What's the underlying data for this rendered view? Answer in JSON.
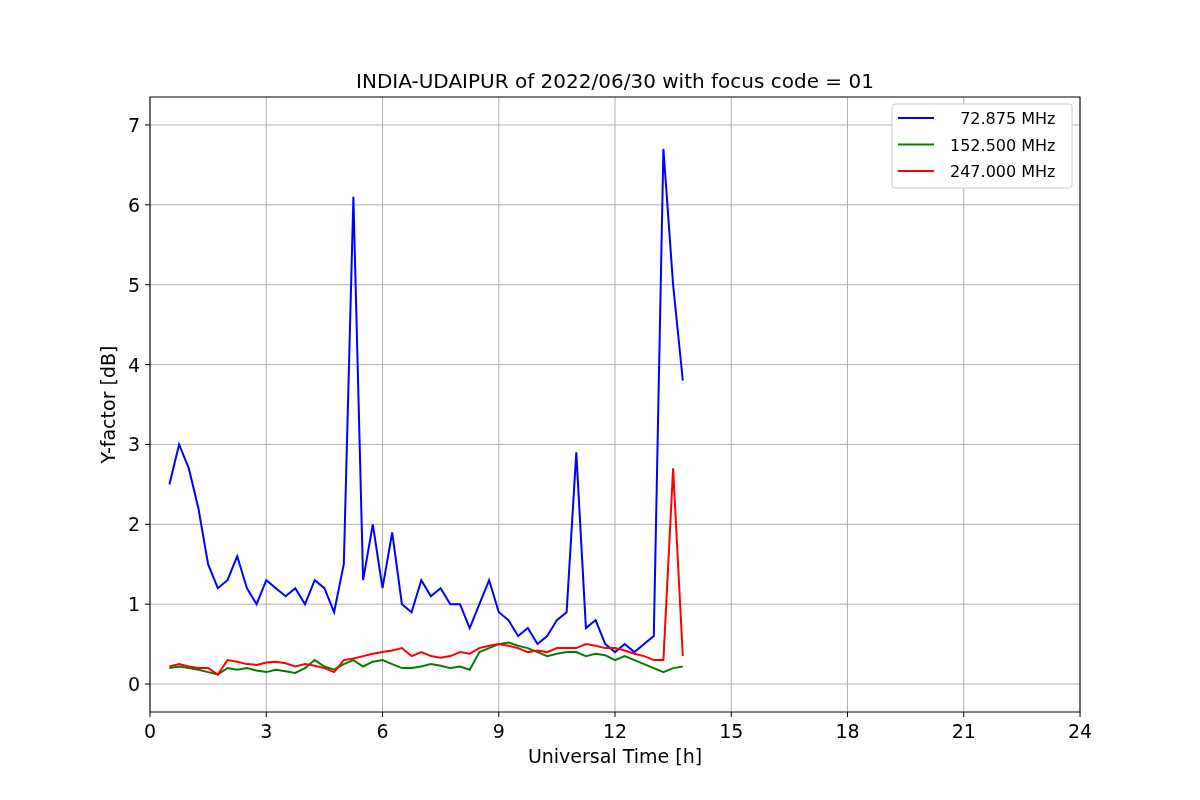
{
  "figure": {
    "chart_data": {
      "type": "line",
      "title": "INDIA-UDAIPUR of 2022/06/30 with focus code = 01",
      "xlabel": "Universal Time [h]",
      "ylabel": "Y-factor [dB]",
      "x": [
        0.5,
        0.75,
        1,
        1.25,
        1.5,
        1.75,
        2,
        2.25,
        2.5,
        2.75,
        3,
        3.25,
        3.5,
        3.75,
        4,
        4.25,
        4.5,
        4.75,
        5,
        5.25,
        5.5,
        5.75,
        6,
        6.25,
        6.5,
        6.75,
        7,
        7.25,
        7.5,
        7.75,
        8,
        8.25,
        8.5,
        8.75,
        9,
        9.25,
        9.5,
        9.75,
        10,
        10.25,
        10.5,
        10.75,
        11,
        11.25,
        11.5,
        11.75,
        12,
        12.25,
        12.5,
        12.75,
        13,
        13.25,
        13.5,
        13.75
      ],
      "series": [
        {
          "name": "  72.875 MHz",
          "color": "#0000ff",
          "values": [
            2.5,
            3.0,
            2.7,
            2.2,
            1.5,
            1.2,
            1.3,
            1.6,
            1.2,
            1.0,
            1.3,
            1.2,
            1.1,
            1.2,
            1.0,
            1.3,
            1.2,
            0.9,
            1.5,
            6.1,
            1.3,
            2.0,
            1.2,
            1.9,
            1.0,
            0.9,
            1.3,
            1.1,
            1.2,
            1.0,
            1.0,
            0.7,
            1.0,
            1.3,
            0.9,
            0.8,
            0.6,
            0.7,
            0.5,
            0.6,
            0.8,
            0.9,
            2.9,
            0.7,
            0.8,
            0.5,
            0.4,
            0.5,
            0.4,
            0.5,
            0.6,
            6.7,
            5.0,
            3.8
          ]
        },
        {
          "name": "152.500 MHz",
          "color": "#008000",
          "values": [
            0.2,
            0.22,
            0.2,
            0.18,
            0.15,
            0.12,
            0.2,
            0.18,
            0.2,
            0.17,
            0.15,
            0.18,
            0.16,
            0.14,
            0.2,
            0.3,
            0.22,
            0.18,
            0.25,
            0.3,
            0.22,
            0.28,
            0.3,
            0.25,
            0.2,
            0.2,
            0.22,
            0.25,
            0.23,
            0.2,
            0.22,
            0.18,
            0.4,
            0.45,
            0.5,
            0.52,
            0.48,
            0.45,
            0.4,
            0.35,
            0.38,
            0.4,
            0.4,
            0.35,
            0.38,
            0.36,
            0.3,
            0.35,
            0.3,
            0.25,
            0.2,
            0.15,
            0.2,
            0.22
          ]
        },
        {
          "name": "247.000 MHz",
          "color": "#ff0000",
          "values": [
            0.22,
            0.25,
            0.22,
            0.2,
            0.2,
            0.12,
            0.3,
            0.28,
            0.25,
            0.24,
            0.27,
            0.28,
            0.26,
            0.22,
            0.25,
            0.23,
            0.2,
            0.15,
            0.3,
            0.32,
            0.35,
            0.38,
            0.4,
            0.42,
            0.45,
            0.35,
            0.4,
            0.35,
            0.33,
            0.35,
            0.4,
            0.38,
            0.45,
            0.48,
            0.5,
            0.48,
            0.45,
            0.4,
            0.42,
            0.4,
            0.45,
            0.45,
            0.45,
            0.5,
            0.48,
            0.45,
            0.45,
            0.42,
            0.38,
            0.35,
            0.3,
            0.3,
            2.7,
            0.35
          ]
        }
      ],
      "grid": true,
      "legend": "upper right",
      "xlim": [
        0,
        24
      ],
      "ylim": [
        -0.35,
        7.35
      ],
      "xticks": [
        0,
        3,
        6,
        9,
        12,
        15,
        18,
        21,
        24
      ],
      "yticks": [
        0,
        1,
        2,
        3,
        4,
        5,
        6,
        7
      ]
    }
  }
}
